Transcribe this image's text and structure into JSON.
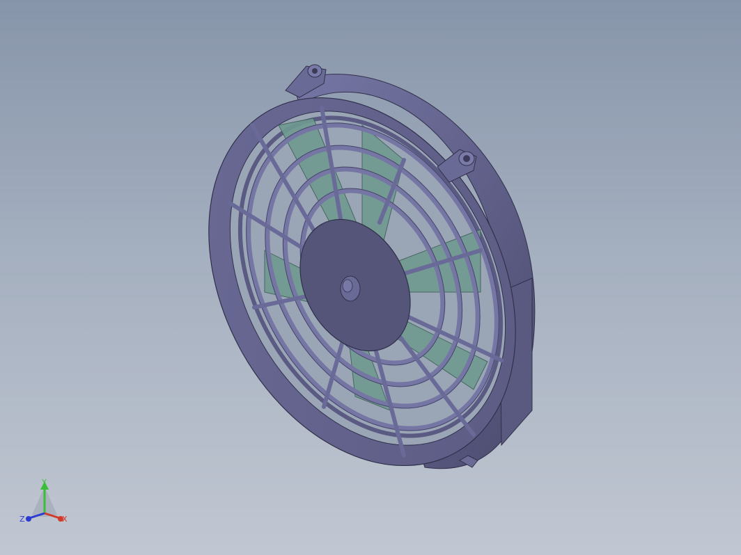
{
  "viewport": {
    "background_top": "#8795aa",
    "background_bottom": "#c1c7d2"
  },
  "model": {
    "name": "fan-guard-assembly",
    "housing_color": "#6b6b95",
    "housing_side_color": "#58587f",
    "grille_color": "#7777a6",
    "blade_color": "#6f9a90",
    "hub_color": "#55557a"
  },
  "triad": {
    "x_label": "X",
    "y_label": "Y",
    "z_label": "Z",
    "x_color": "#d23a2a",
    "y_color": "#3bbf3b",
    "z_color": "#2a3bd2"
  }
}
